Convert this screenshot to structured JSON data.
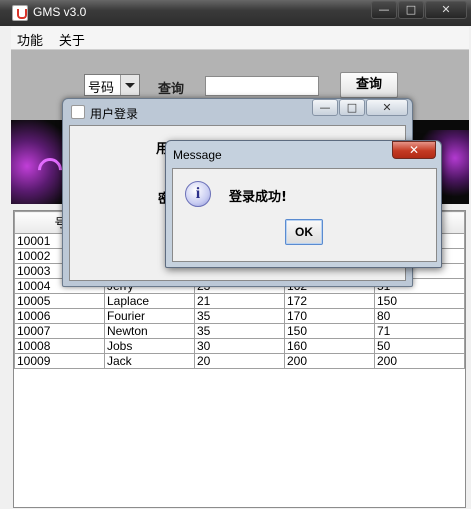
{
  "main_window": {
    "title": "GMS v3.0",
    "controls": {
      "minimize": "—",
      "maximize": "□",
      "close": "✕"
    }
  },
  "menu": [
    "功能",
    "关于"
  ],
  "search": {
    "field_selected": "号码",
    "label": "查询",
    "input_value": "",
    "button_label": "查询"
  },
  "table": {
    "headers": [
      "号",
      "",
      "",
      "",
      ""
    ],
    "rows": [
      [
        "10001",
        "",
        "",
        "",
        ""
      ],
      [
        "10002",
        "",
        "",
        "",
        ""
      ],
      [
        "10003",
        "",
        "",
        "",
        ""
      ],
      [
        "10004",
        "Jerry",
        "23",
        "162",
        "51"
      ],
      [
        "10005",
        "Laplace",
        "21",
        "172",
        "150"
      ],
      [
        "10006",
        "Fourier",
        "35",
        "170",
        "80"
      ],
      [
        "10007",
        "Newton",
        "35",
        "150",
        "71"
      ],
      [
        "10008",
        "Jobs",
        "30",
        "160",
        "50"
      ],
      [
        "10009",
        "Jack",
        "20",
        "200",
        "200"
      ]
    ]
  },
  "login_dialog": {
    "title": "用户登录",
    "username_label": "用户",
    "password_label": "密",
    "controls": {
      "minimize": "—",
      "maximize": "□",
      "close": "✕"
    }
  },
  "message_dialog": {
    "title": "Message",
    "icon": "info-icon",
    "icon_glyph": "i",
    "text": "登录成功!",
    "ok_label": "OK",
    "close_glyph": "✕"
  }
}
